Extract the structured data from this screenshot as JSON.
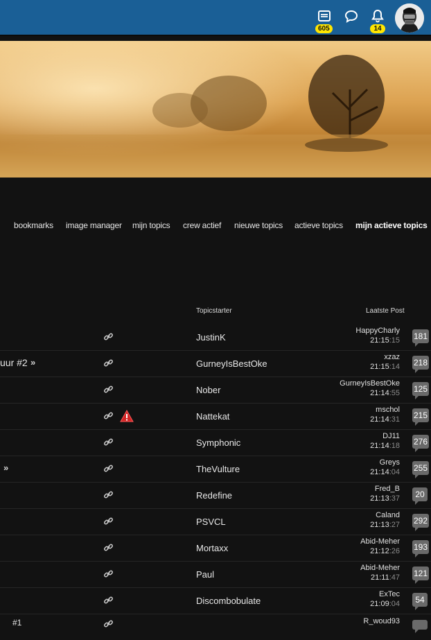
{
  "topbar": {
    "inbox_badge": "605",
    "notifications_badge": "14"
  },
  "nav": {
    "items": [
      {
        "label": "bookmarks"
      },
      {
        "label": "image manager"
      },
      {
        "label": "mijn topics"
      },
      {
        "label": "crew actief"
      },
      {
        "label": "nieuwe topics"
      },
      {
        "label": "actieve topics"
      },
      {
        "label": "mijn actieve topics"
      }
    ]
  },
  "table": {
    "headers": {
      "starter": "Topicstarter",
      "last_post": "Laatste Post"
    },
    "rows": [
      {
        "title_fragment": "",
        "starter": "JustinK",
        "last_user": "HappyCharly",
        "time_hm": "21:15",
        "time_s": ":15",
        "count": "181"
      },
      {
        "title_fragment": "uur #2",
        "starter": "GurneyIsBestOke",
        "last_user": "xzaz",
        "time_hm": "21:15",
        "time_s": ":14",
        "count": "218"
      },
      {
        "title_fragment": "",
        "starter": "Nober",
        "last_user": "GurneyIsBestOke",
        "time_hm": "21:14",
        "time_s": ":55",
        "count": "125"
      },
      {
        "title_fragment": "",
        "starter": "Nattekat",
        "last_user": "mschol",
        "time_hm": "21:14",
        "time_s": ":31",
        "count": "215"
      },
      {
        "title_fragment": "",
        "starter": "Symphonic",
        "last_user": "DJ11",
        "time_hm": "21:14",
        "time_s": ":18",
        "count": "276"
      },
      {
        "title_fragment": "",
        "starter": "TheVulture",
        "last_user": "Greys",
        "time_hm": "21:14",
        "time_s": ":04",
        "count": "255"
      },
      {
        "title_fragment": "",
        "starter": "Redefine",
        "last_user": "Fred_B",
        "time_hm": "21:13",
        "time_s": ":37",
        "count": "20"
      },
      {
        "title_fragment": "",
        "starter": "PSVCL",
        "last_user": "Caland",
        "time_hm": "21:13",
        "time_s": ":27",
        "count": "292"
      },
      {
        "title_fragment": "",
        "starter": "Mortaxx",
        "last_user": "Abid-Meher",
        "time_hm": "21:12",
        "time_s": ":26",
        "count": "193"
      },
      {
        "title_fragment": "",
        "starter": "Paul",
        "last_user": "Abid-Meher",
        "time_hm": "21:11",
        "time_s": ":47",
        "count": "121"
      },
      {
        "title_fragment": "",
        "starter": "Discombobulate",
        "last_user": "ExTec",
        "time_hm": "21:09",
        "time_s": ":04",
        "count": "54"
      },
      {
        "title_fragment": "#1",
        "starter": "",
        "last_user": "R_woud93",
        "time_hm": "",
        "time_s": "",
        "count": ""
      }
    ]
  }
}
